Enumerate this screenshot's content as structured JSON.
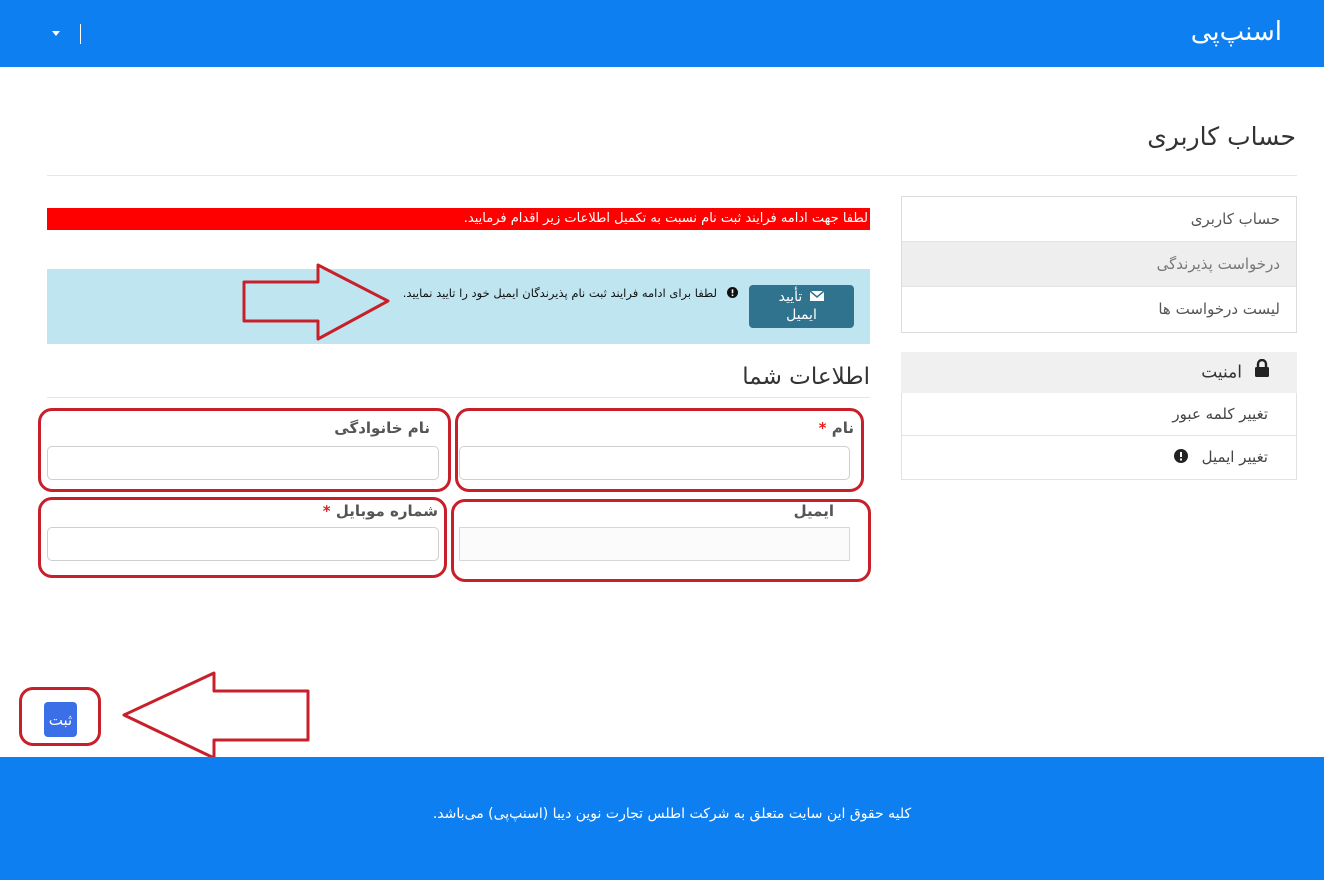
{
  "header": {
    "brand": "اسنپ‌پی"
  },
  "page": {
    "title": "حساب کاربری"
  },
  "sidebar": {
    "items": [
      {
        "label": "حساب کاربری"
      },
      {
        "label": "درخواست پذیرندگی"
      },
      {
        "label": "لیست درخواست ها"
      }
    ],
    "security": {
      "heading": "امنیت",
      "items": [
        {
          "label": "تغییر کلمه عبور"
        },
        {
          "label": "تغییر ایمیل"
        }
      ]
    }
  },
  "alerts": {
    "red": "لطفا جهت ادامه فرایند ثبت نام نسبت به تکمیل اطلاعات زیر اقدام فرمایید.",
    "info": {
      "button_line1": "تأیید",
      "button_line2": "ایمیل",
      "text": "لطفا برای ادامه فرایند ثبت نام پذیرندگان ایمیل خود را تایید نمایید."
    }
  },
  "form": {
    "section_title": "اطلاعات شما",
    "first_name": {
      "label": "نام",
      "value": ""
    },
    "last_name": {
      "label": "نام خانوادگی",
      "value": ""
    },
    "email": {
      "label": "ایمیل",
      "value": ""
    },
    "mobile": {
      "label": "شماره موبایل",
      "value": ""
    },
    "required_mark": "*",
    "submit_label": "ثبت"
  },
  "footer": {
    "text": "کلیه حقوق این سایت متعلق به شرکت اطلس تجارت نوین دیبا (اسنپ‌پی) می‌باشد."
  },
  "colors": {
    "primary": "#0d7ff0",
    "alert_red": "#ff0000",
    "info_bg": "#bfe6f0",
    "annotation": "#c8202a"
  }
}
